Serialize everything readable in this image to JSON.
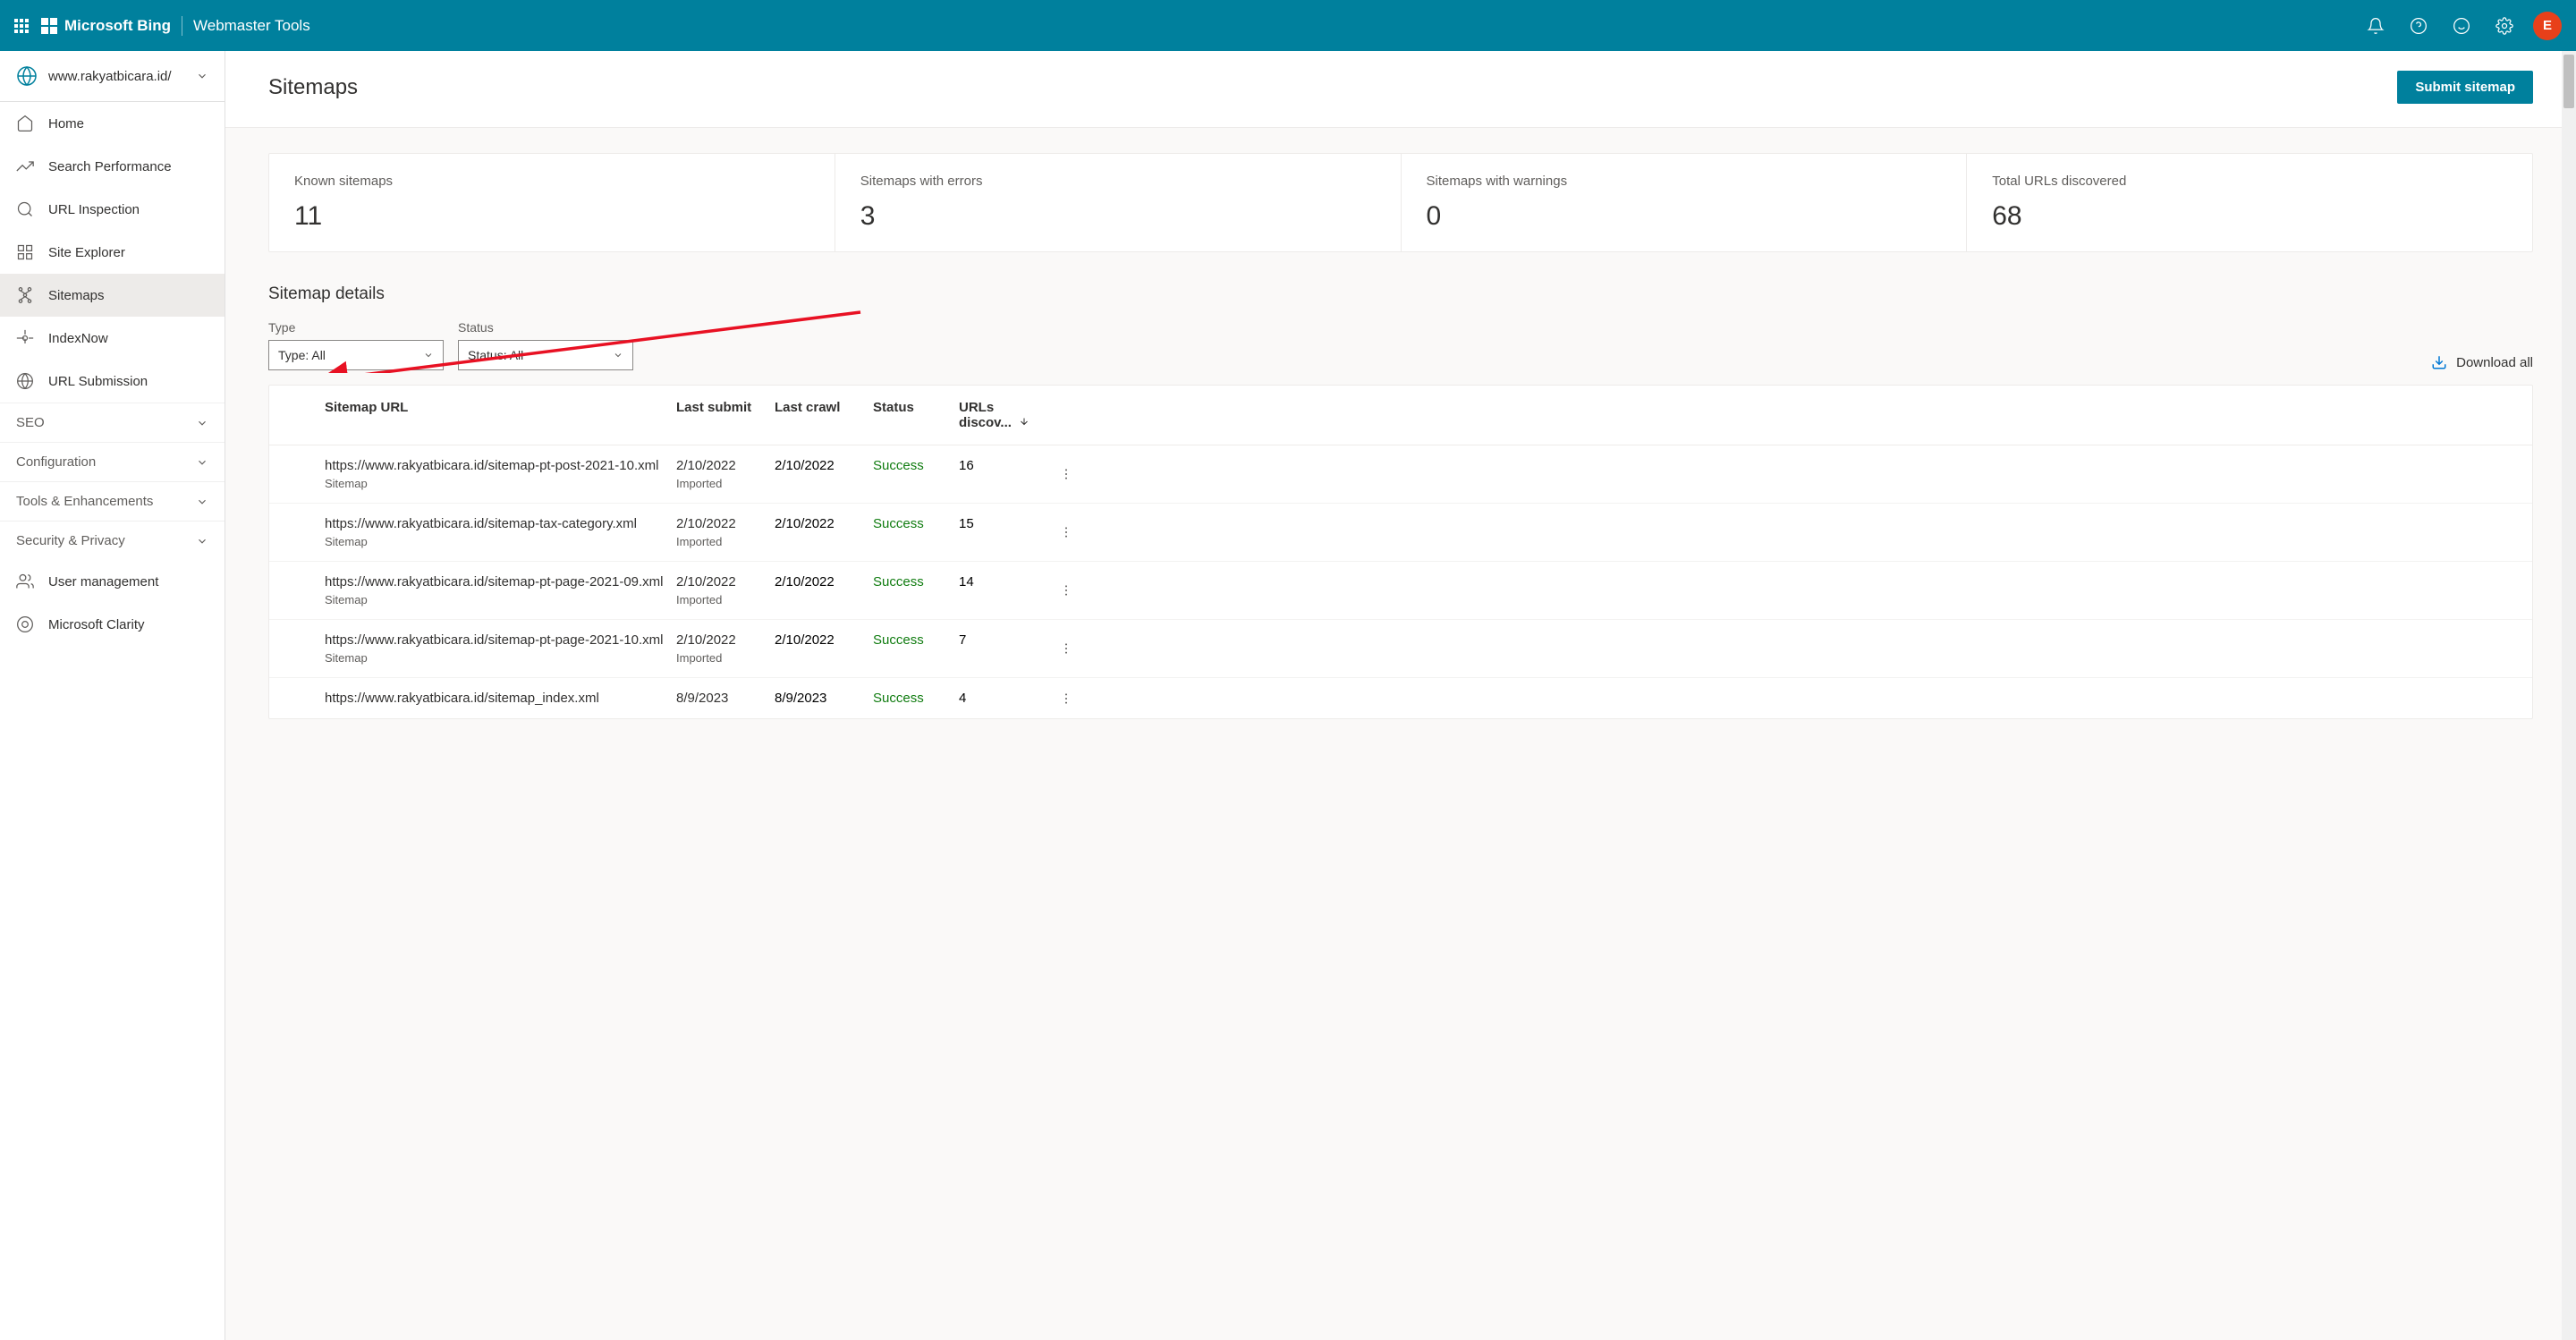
{
  "header": {
    "brand": "Microsoft Bing",
    "subtitle": "Webmaster Tools",
    "avatar_letter": "E"
  },
  "sidebar": {
    "site": "www.rakyatbicara.id/",
    "items": [
      {
        "label": "Home",
        "active": false
      },
      {
        "label": "Search Performance",
        "active": false
      },
      {
        "label": "URL Inspection",
        "active": false
      },
      {
        "label": "Site Explorer",
        "active": false
      },
      {
        "label": "Sitemaps",
        "active": true
      },
      {
        "label": "IndexNow",
        "active": false
      },
      {
        "label": "URL Submission",
        "active": false
      }
    ],
    "sections": [
      {
        "label": "SEO"
      },
      {
        "label": "Configuration"
      },
      {
        "label": "Tools & Enhancements"
      },
      {
        "label": "Security & Privacy"
      }
    ],
    "bottom_items": [
      {
        "label": "User management"
      },
      {
        "label": "Microsoft Clarity"
      }
    ]
  },
  "page": {
    "title": "Sitemaps",
    "submit_button": "Submit sitemap",
    "stats": [
      {
        "label": "Known sitemaps",
        "value": "11"
      },
      {
        "label": "Sitemaps with errors",
        "value": "3"
      },
      {
        "label": "Sitemaps with warnings",
        "value": "0"
      },
      {
        "label": "Total URLs discovered",
        "value": "68"
      }
    ],
    "section_title": "Sitemap details",
    "filters": {
      "type_label": "Type",
      "type_value": "Type: All",
      "status_label": "Status",
      "status_value": "Status: All"
    },
    "download_all": "Download all",
    "columns": {
      "url": "Sitemap URL",
      "submit": "Last submit",
      "crawl": "Last crawl",
      "status": "Status",
      "urls": "URLs discov..."
    },
    "rows": [
      {
        "url": "https://www.rakyatbicara.id/sitemap-pt-post-2021-10.xml",
        "type": "Sitemap",
        "submit": "2/10/2022",
        "submit_sub": "Imported",
        "crawl": "2/10/2022",
        "status": "Success",
        "urls": "16"
      },
      {
        "url": "https://www.rakyatbicara.id/sitemap-tax-category.xml",
        "type": "Sitemap",
        "submit": "2/10/2022",
        "submit_sub": "Imported",
        "crawl": "2/10/2022",
        "status": "Success",
        "urls": "15"
      },
      {
        "url": "https://www.rakyatbicara.id/sitemap-pt-page-2021-09.xml",
        "type": "Sitemap",
        "submit": "2/10/2022",
        "submit_sub": "Imported",
        "crawl": "2/10/2022",
        "status": "Success",
        "urls": "14"
      },
      {
        "url": "https://www.rakyatbicara.id/sitemap-pt-page-2021-10.xml",
        "type": "Sitemap",
        "submit": "2/10/2022",
        "submit_sub": "Imported",
        "crawl": "2/10/2022",
        "status": "Success",
        "urls": "7"
      },
      {
        "url": "https://www.rakyatbicara.id/sitemap_index.xml",
        "type": "",
        "submit": "8/9/2023",
        "submit_sub": "",
        "crawl": "8/9/2023",
        "status": "Success",
        "urls": "4"
      }
    ]
  }
}
